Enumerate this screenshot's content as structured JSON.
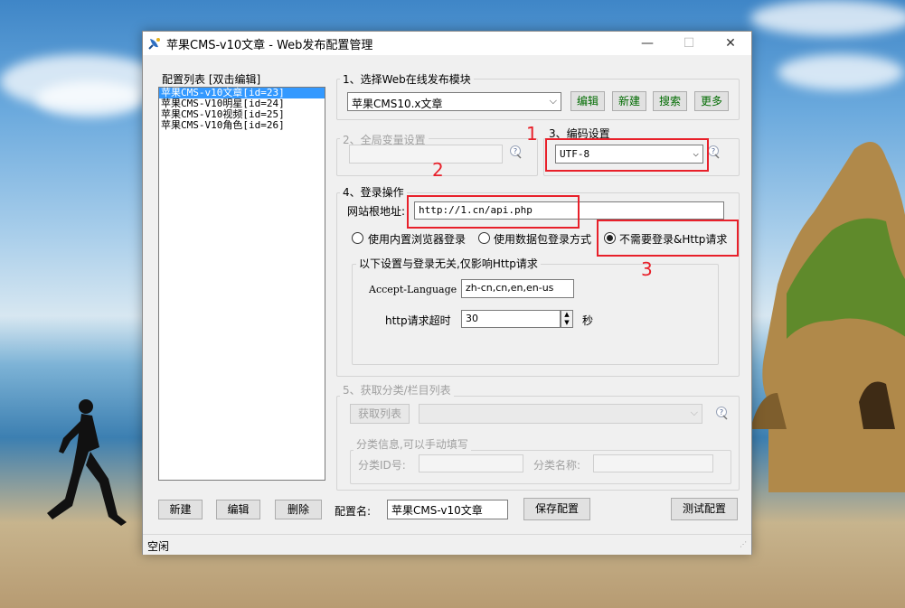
{
  "window": {
    "title": "苹果CMS-v10文章 - Web发布配置管理"
  },
  "config_list": {
    "header": "配置列表 [双击编辑]",
    "items": [
      {
        "label": "苹果CMS-v10文章[id=23]",
        "selected": true
      },
      {
        "label": "苹果CMS-V10明星[id=24]",
        "selected": false
      },
      {
        "label": "苹果CMS-V10视频[id=25]",
        "selected": false
      },
      {
        "label": "苹果CMS-V10角色[id=26]",
        "selected": false
      }
    ]
  },
  "section1": {
    "title": "1、选择Web在线发布模块",
    "module_value": "苹果CMS10.x文章",
    "edit_label": "编辑",
    "new_label": "新建",
    "search_label": "搜索",
    "more_label": "更多"
  },
  "section2": {
    "title": "2、全局变量设置",
    "value": ""
  },
  "section3": {
    "title": "3、编码设置",
    "encoding_value": "UTF-8"
  },
  "section4": {
    "title": "4、登录操作",
    "root_url_label": "网站根地址:",
    "root_url_value": "http://1.cn/api.php",
    "radio_builtin": "使用内置浏览器登录",
    "radio_packet": "使用数据包登录方式",
    "radio_none": "不需要登录&Http请求",
    "http_group_title": "以下设置与登录无关,仅影响Http请求",
    "accept_language_label": "Accept-Language",
    "accept_language_value": "zh-cn,cn,en,en-us",
    "timeout_label": "http请求超时",
    "timeout_value": "30",
    "timeout_unit": "秒"
  },
  "section5": {
    "title": "5、获取分类/栏目列表",
    "fetch_label": "获取列表",
    "category_group_title": "分类信息,可以手动填写",
    "category_id_label": "分类ID号:",
    "category_name_label": "分类名称:"
  },
  "bottom": {
    "new_label": "新建",
    "edit_label": "编辑",
    "delete_label": "删除",
    "config_name_label": "配置名:",
    "config_name_value": "苹果CMS-v10文章",
    "save_label": "保存配置",
    "test_label": "测试配置"
  },
  "status": {
    "text": "空闲"
  },
  "annotations": {
    "one": "1",
    "two": "2",
    "three": "3"
  },
  "colors": {
    "annotation": "#e8202a",
    "selection": "#3399ff",
    "action_text": "#006b00"
  }
}
